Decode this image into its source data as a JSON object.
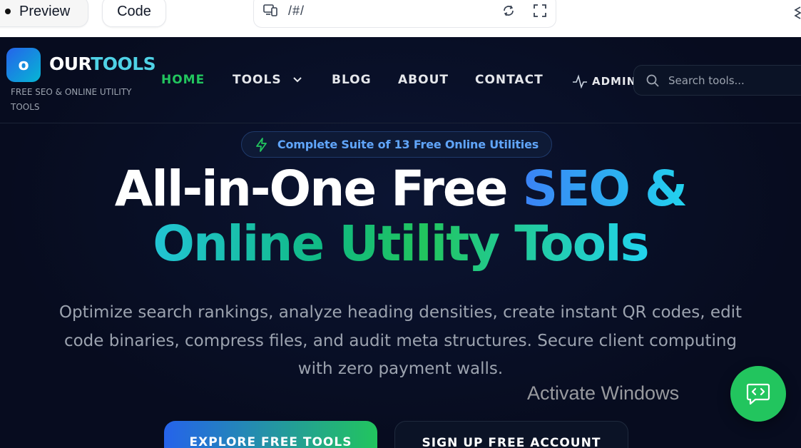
{
  "editor": {
    "preview_label": "Preview",
    "code_label": "Code",
    "url": "/#/"
  },
  "nav": {
    "logo_letter": "o",
    "brand_part1": "OUR",
    "brand_part2": "TOOLS",
    "tagline": "FREE SEO & ONLINE UTILITY TOOLS",
    "links": {
      "home": "HOME",
      "tools": "TOOLS",
      "blog": "BLOG",
      "about": "ABOUT",
      "contact": "CONTACT",
      "admin": "ADMIN"
    },
    "search_placeholder": "Search tools..."
  },
  "hero": {
    "badge": "Complete Suite of 13 Free Online Utilities",
    "title_line1_white": "All-in-One Free ",
    "title_line1_accent": "SEO &",
    "title_line2": "Online Utility Tools",
    "subtitle_line1": "Optimize search rankings, analyze heading densities, create instant QR codes, edit",
    "subtitle_line2": "code binaries, compress files, and audit meta structures. Secure client computing",
    "subtitle_line3": "with zero payment walls.",
    "cta_primary": "EXPLORE FREE TOOLS",
    "cta_secondary": "SIGN UP FREE ACCOUNT"
  },
  "overlay": {
    "watermark": "Activate Windows"
  },
  "colors": {
    "background": "#070c1f",
    "accent_green": "#22c55e",
    "accent_blue": "#3b82f6",
    "accent_cyan": "#22d3ee"
  },
  "icons": {
    "device": "devices-icon",
    "refresh": "refresh-icon",
    "fullscreen": "fullscreen-icon",
    "chevron": "chevron-down-icon",
    "activity": "activity-icon",
    "search": "search-icon",
    "bolt": "bolt-icon",
    "chat": "code-chat-icon"
  }
}
